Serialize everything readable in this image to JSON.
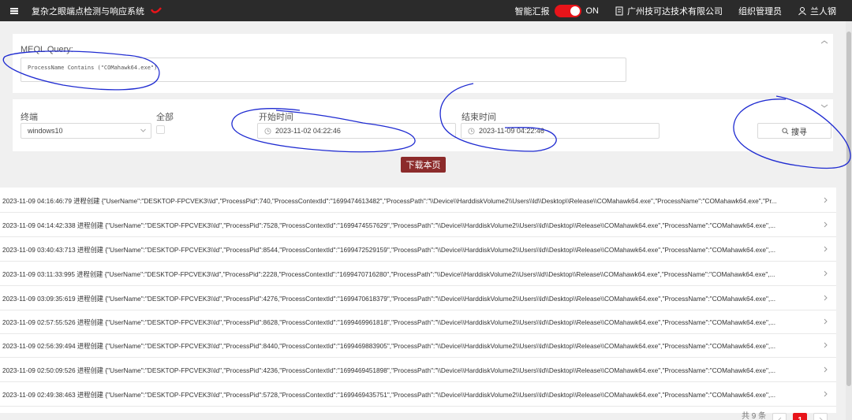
{
  "header": {
    "app_title": "复杂之眼端点检测与响应系统",
    "smart_report_label": "智能汇报",
    "toggle_state": "ON",
    "company": "广州技可达技术有限公司",
    "role": "组织管理员",
    "user": "兰人钢"
  },
  "query": {
    "label": "MEQL Query:",
    "value": "ProcessName Contains (\"COMahawk64.exe\")"
  },
  "filters": {
    "terminal_label": "终端",
    "terminal_value": "windows10",
    "all_label": "全部",
    "start_label": "开始时间",
    "start_value": "2023-11-02 04:22:46",
    "end_label": "结束时间",
    "end_value": "2023-11-09 04:22:46",
    "search_label": "搜寻"
  },
  "download_label": "下载本页",
  "rows": [
    "2023-11-09 04:16:46:79 进程创建 {\"UserName\":\"DESKTOP-FPCVEK3\\\\ld\",\"ProcessPid\":740,\"ProcessContextId\":\"1699474613482\",\"ProcessPath\":\"\\\\Device\\\\HarddiskVolume2\\\\Users\\\\ld\\\\Desktop\\\\Release\\\\COMahawk64.exe\",\"ProcessName\":\"COMahawk64.exe\",\"Pr...",
    "2023-11-09 04:14:42:338 进程创建 {\"UserName\":\"DESKTOP-FPCVEK3\\\\ld\",\"ProcessPid\":7528,\"ProcessContextId\":\"1699474557629\",\"ProcessPath\":\"\\\\Device\\\\HarddiskVolume2\\\\Users\\\\ld\\\\Desktop\\\\Release\\\\COMahawk64.exe\",\"ProcessName\":\"COMahawk64.exe\",...",
    "2023-11-09 03:40:43:713 进程创建 {\"UserName\":\"DESKTOP-FPCVEK3\\\\ld\",\"ProcessPid\":8544,\"ProcessContextId\":\"1699472529159\",\"ProcessPath\":\"\\\\Device\\\\HarddiskVolume2\\\\Users\\\\ld\\\\Desktop\\\\Release\\\\COMahawk64.exe\",\"ProcessName\":\"COMahawk64.exe\",...",
    "2023-11-09 03:11:33:995 进程创建 {\"UserName\":\"DESKTOP-FPCVEK3\\\\ld\",\"ProcessPid\":2228,\"ProcessContextId\":\"1699470716280\",\"ProcessPath\":\"\\\\Device\\\\HarddiskVolume2\\\\Users\\\\ld\\\\Desktop\\\\Release\\\\COMahawk64.exe\",\"ProcessName\":\"COMahawk64.exe\",...",
    "2023-11-09 03:09:35:619 进程创建 {\"UserName\":\"DESKTOP-FPCVEK3\\\\ld\",\"ProcessPid\":4276,\"ProcessContextId\":\"1699470618379\",\"ProcessPath\":\"\\\\Device\\\\HarddiskVolume2\\\\Users\\\\ld\\\\Desktop\\\\Release\\\\COMahawk64.exe\",\"ProcessName\":\"COMahawk64.exe\",...",
    "2023-11-09 02:57:55:526 进程创建 {\"UserName\":\"DESKTOP-FPCVEK3\\\\ld\",\"ProcessPid\":8628,\"ProcessContextId\":\"1699469961818\",\"ProcessPath\":\"\\\\Device\\\\HarddiskVolume2\\\\Users\\\\ld\\\\Desktop\\\\Release\\\\COMahawk64.exe\",\"ProcessName\":\"COMahawk64.exe\",...",
    "2023-11-09 02:56:39:494 进程创建 {\"UserName\":\"DESKTOP-FPCVEK3\\\\ld\",\"ProcessPid\":8440,\"ProcessContextId\":\"1699469883905\",\"ProcessPath\":\"\\\\Device\\\\HarddiskVolume2\\\\Users\\\\ld\\\\Desktop\\\\Release\\\\COMahawk64.exe\",\"ProcessName\":\"COMahawk64.exe\",...",
    "2023-11-09 02:50:09:526 进程创建 {\"UserName\":\"DESKTOP-FPCVEK3\\\\ld\",\"ProcessPid\":4236,\"ProcessContextId\":\"1699469451898\",\"ProcessPath\":\"\\\\Device\\\\HarddiskVolume2\\\\Users\\\\ld\\\\Desktop\\\\Release\\\\COMahawk64.exe\",\"ProcessName\":\"COMahawk64.exe\",...",
    "2023-11-09 02:49:38:463 进程创建 {\"UserName\":\"DESKTOP-FPCVEK3\\\\ld\",\"ProcessPid\":5728,\"ProcessContextId\":\"1699469435751\",\"ProcessPath\":\"\\\\Device\\\\HarddiskVolume2\\\\Users\\\\ld\\\\Desktop\\\\Release\\\\COMahawk64.exe\",\"ProcessName\":\"COMahawk64.exe\",..."
  ],
  "pagination": {
    "total_text": "共 9 条",
    "current_page": "1"
  },
  "colors": {
    "accent": "#e8141a",
    "download_button": "#8c2b2b",
    "topbar": "#2b2b2b",
    "annotation_ink": "#1f2bd1"
  },
  "icons": [
    "menu-icon",
    "logo-icon",
    "building-icon",
    "user-icon",
    "chevron-up-icon",
    "chevron-down-icon",
    "clock-icon",
    "search-icon",
    "chevron-right-icon",
    "chevron-left-icon"
  ]
}
